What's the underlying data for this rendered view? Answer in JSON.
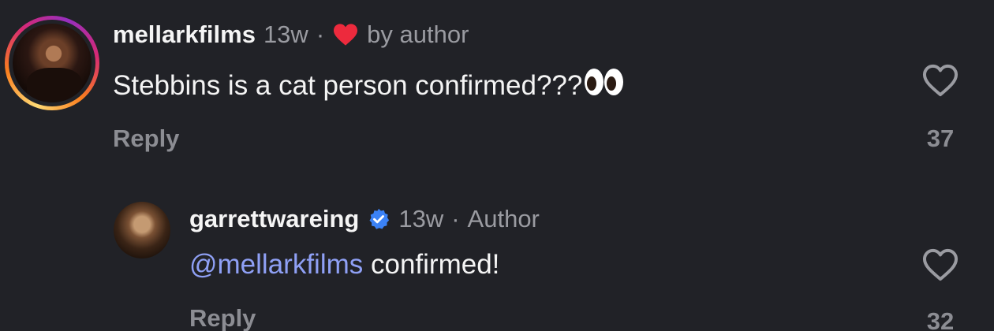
{
  "comments": [
    {
      "username": "mellarkfilms",
      "time": "13w",
      "separator": "·",
      "liked_by_author_label": "by author",
      "text": "Stebbins is a cat person confirmed???",
      "emoji_icon": "eyes-emoji-icon",
      "reply_label": "Reply",
      "like_count": "37",
      "avatar_ring": "instagram-story-gradient"
    },
    {
      "username": "garrettwareing",
      "verified": true,
      "time": "13w",
      "separator": "·",
      "badge": "Author",
      "mention": "@mellarkfilms",
      "text": " confirmed!",
      "reply_label": "Reply",
      "like_count": "32"
    }
  ],
  "colors": {
    "background": "#212227",
    "mention": "#8fa0f5",
    "heart": "#ed2a3d",
    "verified": "#3b82f6",
    "muted": "#9a9ba1"
  }
}
